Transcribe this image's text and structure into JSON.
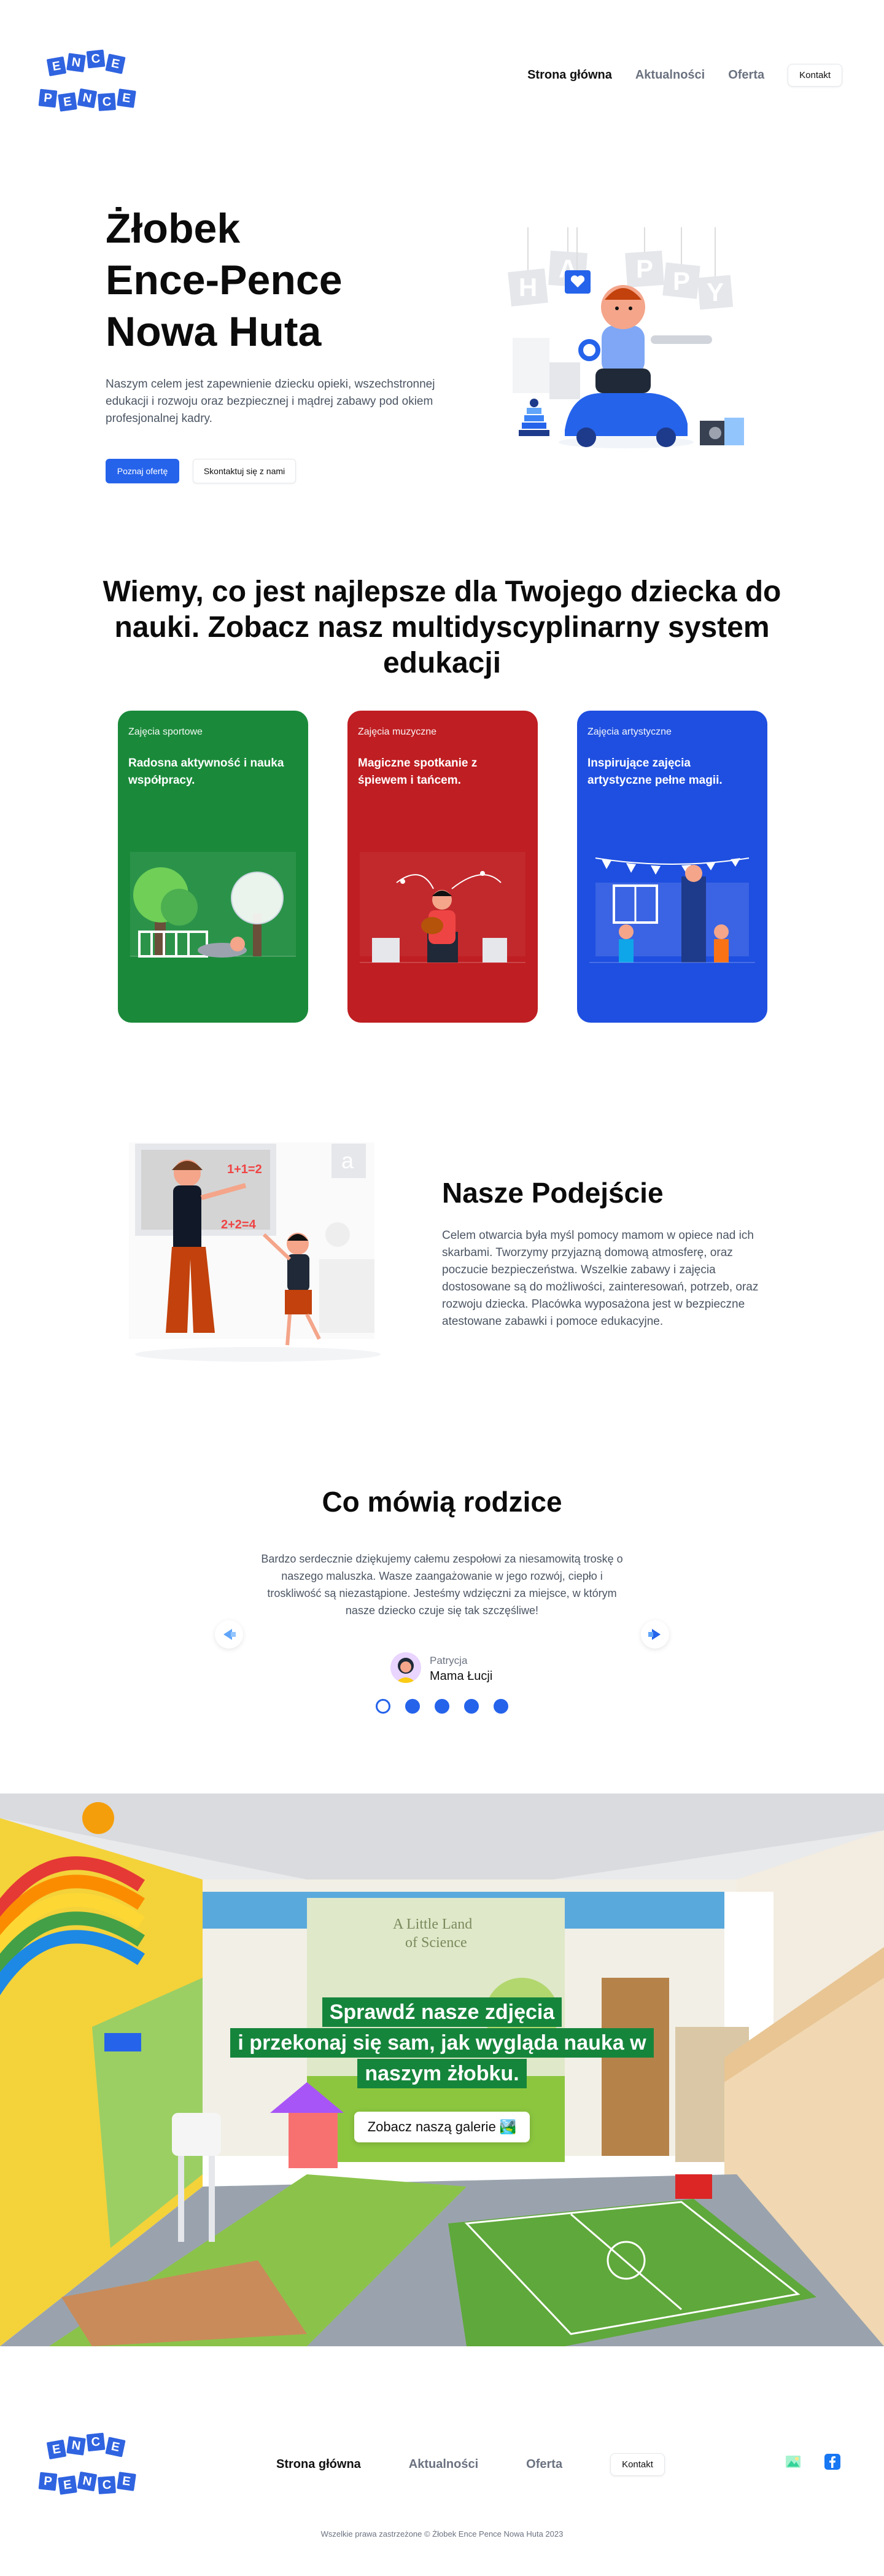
{
  "logo": {
    "top_letters": [
      "E",
      "N",
      "C",
      "E"
    ],
    "bottom_letters": [
      "P",
      "E",
      "N",
      "C",
      "E"
    ]
  },
  "nav": {
    "items": [
      {
        "label": "Strona główna",
        "active": true
      },
      {
        "label": "Aktualności",
        "active": false
      },
      {
        "label": "Oferta",
        "active": false
      }
    ],
    "contact_button": "Kontakt"
  },
  "hero": {
    "title_lines": [
      "Żłobek",
      "Ence-Pence",
      "Nowa Huta"
    ],
    "description": "Naszym celem jest zapewnienie dziecku opieki, wszechstronnej edukacji i rozwoju oraz bezpiecznej i mądrej zabawy pod okiem profesjonalnej kadry.",
    "primary_button": "Poznaj ofertę",
    "secondary_button": "Skontaktuj się z nami",
    "illustration_letters": [
      "H",
      "A",
      "P",
      "P",
      "Y"
    ]
  },
  "education": {
    "title": "Wiemy, co jest najlepsze dla Twojego dziecka do nauki. Zobacz nasz multidyscyplinarny system edukacji",
    "cards": [
      {
        "category": "Zajęcia sportowe",
        "description": "Radosna aktywność i nauka współpracy.",
        "color": "#1a8a3a",
        "icon": "playground-illustration"
      },
      {
        "category": "Zajęcia muzyczne",
        "description": "Magiczne spotkanie z śpiewem i tańcem.",
        "color": "#bf1e22",
        "icon": "music-illustration"
      },
      {
        "category": "Zajęcia artystyczne",
        "description": "Inspirujące zajęcia artystyczne pełne magii.",
        "color": "#1f4fe0",
        "icon": "art-illustration"
      }
    ]
  },
  "approach": {
    "title": "Nasze Podejście",
    "text": "Celem otwarcia była myśl pomocy mamom w opiece nad ich skarbami. Tworzymy przyjazną domową atmosferę, oraz poczucie bezpieczeństwa. Wszelkie zabawy i zajęcia dostosowane są do możliwości, zainteresowań, potrzeb, oraz rozwoju dziecka. Placówka wyposażona jest w bezpieczne atestowane zabawki i pomoce edukacyjne.",
    "board_text_1": "1+1=2",
    "board_text_2": "2+2=4",
    "board_letter": "a"
  },
  "testimonials": {
    "title": "Co mówią rodzice",
    "quote": "Bardzo serdecznie dziękujemy całemu zespołowi za niesamowitą troskę o naszego maluszka. Wasze zaangażowanie w jego rozwój, ciepło i troskliwość są niezastąpione. Jesteśmy wdzięczni za miejsce, w którym nasze dziecko czuje się tak szczęśliwe!",
    "author_name": "Patrycja",
    "author_role": "Mama Łucji",
    "dots": 5,
    "active_dot": 0
  },
  "gallery": {
    "line1": "Sprawdź nasze zdjęcia",
    "line2": "i przekonaj się sam, jak wygląda nauka w",
    "line3": "naszym żłobku.",
    "button": "Zobacz naszą galerie 🏞️",
    "wall_text_1": "A Little Land",
    "wall_text_2": "of Science"
  },
  "footer": {
    "copyright": "Wszelkie prawa zastrzeżone © Żłobek Ence Pence Nowa Huta 2023"
  },
  "colors": {
    "accent": "#2563eb",
    "green": "#1a8a3a",
    "red": "#bf1e22",
    "blue": "#1f4fe0"
  }
}
